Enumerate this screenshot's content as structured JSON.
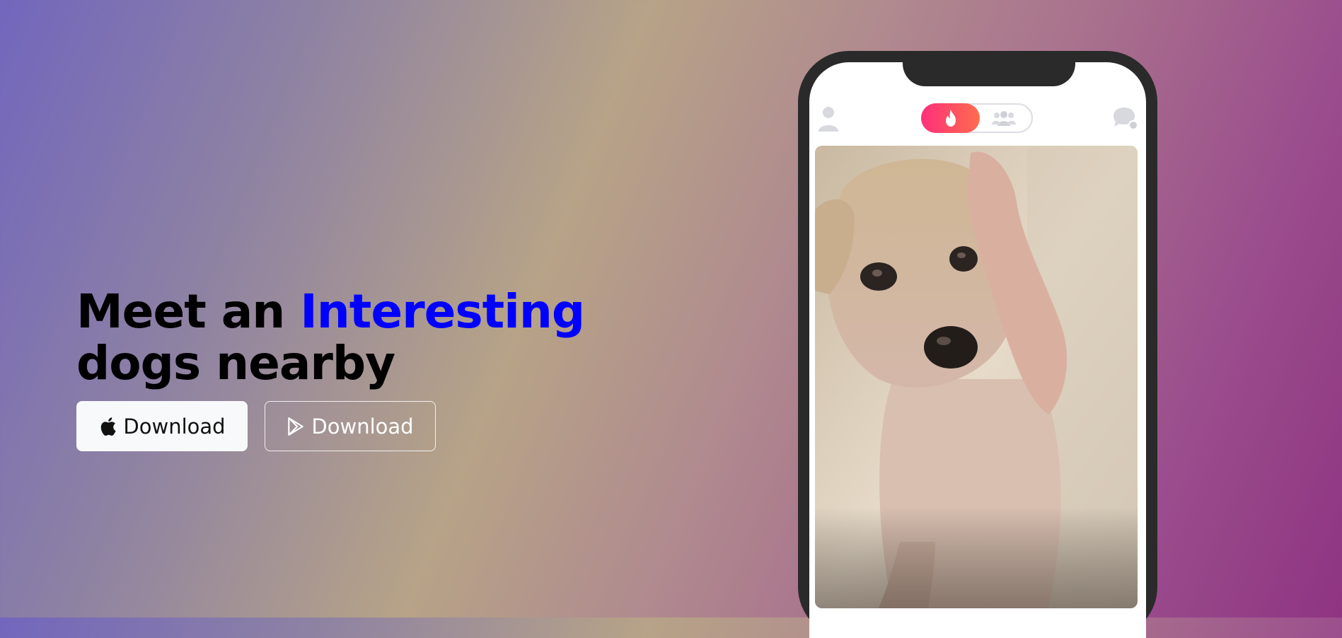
{
  "hero": {
    "headline_part1": "Meet an ",
    "headline_accent": "Interesting",
    "headline_part2": "dogs nearby"
  },
  "buttons": {
    "ios_label": "Download",
    "ios_icon": "apple-icon",
    "play_label": "Download",
    "play_icon": "google-play-icon"
  },
  "phone": {
    "top_bar_icons": [
      "profile-icon",
      "flame-icon",
      "group-icon",
      "chat-icon"
    ],
    "toggle_active": "flame",
    "card_image": "dog-photo"
  },
  "colors": {
    "headline": "#000000",
    "accent": "#0000ff",
    "toggle_gradient_start": "#fd2f7a",
    "toggle_gradient_end": "#ff6c4e",
    "gradient_start": "#7266bd",
    "gradient_end": "#8f3482"
  }
}
